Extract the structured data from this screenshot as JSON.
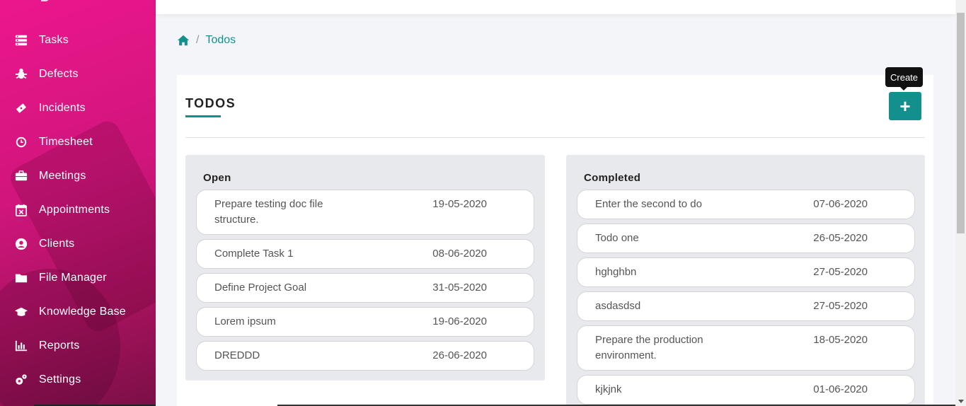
{
  "sidebar": {
    "items": [
      {
        "label": "Tasks",
        "icon": "tasks-icon"
      },
      {
        "label": "Defects",
        "icon": "bug-icon"
      },
      {
        "label": "Incidents",
        "icon": "ticket-icon"
      },
      {
        "label": "Timesheet",
        "icon": "clock-icon"
      },
      {
        "label": "Meetings",
        "icon": "briefcase-icon"
      },
      {
        "label": "Appointments",
        "icon": "calendar-x-icon"
      },
      {
        "label": "Clients",
        "icon": "user-circle-icon"
      },
      {
        "label": "File Manager",
        "icon": "folder-icon"
      },
      {
        "label": "Knowledge Base",
        "icon": "graduation-cap-icon"
      },
      {
        "label": "Reports",
        "icon": "bar-chart-icon"
      },
      {
        "label": "Settings",
        "icon": "cogs-icon"
      }
    ]
  },
  "breadcrumb": {
    "separator": "/",
    "current": "Todos"
  },
  "page": {
    "title": "TODOS",
    "create_tooltip": "Create"
  },
  "open": {
    "title": "Open",
    "items": [
      {
        "text": "Prepare testing doc file structure.",
        "date": "19-05-2020"
      },
      {
        "text": "Complete Task 1",
        "date": "08-06-2020"
      },
      {
        "text": "Define Project Goal",
        "date": "31-05-2020"
      },
      {
        "text": "Lorem ipsum",
        "date": "19-06-2020"
      },
      {
        "text": "DREDDD",
        "date": "26-06-2020"
      }
    ]
  },
  "completed": {
    "title": "Completed",
    "items": [
      {
        "text": "Enter the second to do",
        "date": "07-06-2020"
      },
      {
        "text": "Todo one",
        "date": "26-05-2020"
      },
      {
        "text": "hghghbn",
        "date": "27-05-2020"
      },
      {
        "text": "asdasdsd",
        "date": "27-05-2020"
      },
      {
        "text": "Prepare the production environment.",
        "date": "18-05-2020"
      },
      {
        "text": "kjkjnk",
        "date": "01-06-2020"
      }
    ]
  },
  "colors": {
    "accent": "#13908e",
    "sidebar_pink": "#ec168c"
  }
}
